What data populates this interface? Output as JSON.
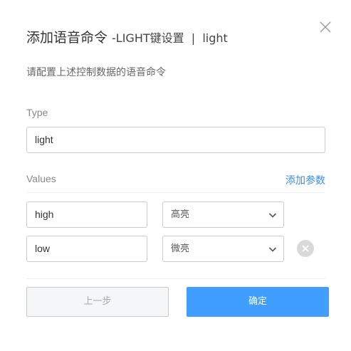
{
  "dialog": {
    "title": "添加语音命令",
    "title_suffix": "-LIGHT键设置  |  light",
    "subtitle": "请配置上述控制数据的语音命令"
  },
  "type_field": {
    "label": "Type",
    "value": "light"
  },
  "values_section": {
    "label": "Values",
    "add_param_label": "添加参数",
    "rows": [
      {
        "value": "high",
        "selected": "高亮",
        "removable": false
      },
      {
        "value": "low",
        "selected": "微亮",
        "removable": true
      }
    ]
  },
  "footer": {
    "prev_label": "上一步",
    "ok_label": "确定"
  },
  "colors": {
    "accent": "#409efe",
    "link": "#3a8ee6",
    "remove_icon_bg": "#d9d9d9"
  },
  "icons": {
    "close": "close-icon",
    "chevron": "chevron-down-icon",
    "remove": "remove-circle-icon"
  }
}
